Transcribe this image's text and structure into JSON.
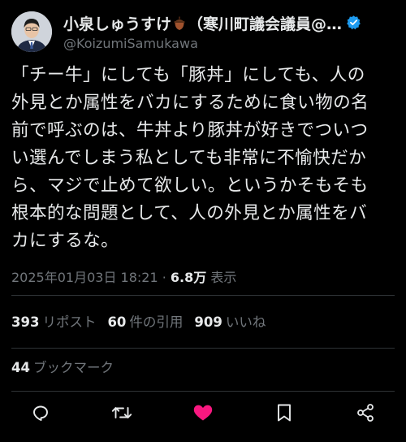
{
  "author": {
    "display_name_prefix": "小泉しゅうすけ",
    "display_name_suffix": "（寒川町議会議員@…",
    "handle": "@KoizumiSamukawa",
    "verified": true
  },
  "tweet": {
    "lines": [
      "「チー牛」にしても「豚丼」にしても、人の",
      "外見とか属性をバカにするために食い物の名",
      "前で呼ぶのは、牛丼より豚丼が好きでついつ",
      "い選んでしまう私としても非常に不愉快だか",
      "ら、マジで止めて欲しい。というかそもそも",
      "根本的な問題として、人の外見とか属性をバ",
      "カにするな。"
    ]
  },
  "meta": {
    "timestamp": "2025年01月03日 18:21",
    "separator": " · ",
    "views_count": "6.8万",
    "views_label": " 表示"
  },
  "stats": {
    "reposts_count": "393",
    "reposts_label": "リポスト",
    "quotes_count": "60",
    "quotes_label": "件の引用",
    "likes_count": "909",
    "likes_label": "いいね"
  },
  "bookmarks": {
    "count": "44",
    "label": "ブックマーク"
  },
  "colors": {
    "background": "#000000",
    "text": "#e7e9ea",
    "muted": "#71767b",
    "like_active": "#f91880",
    "verified": "#1d9bf0",
    "divider": "#2f3336"
  },
  "icons": [
    "acorn-icon",
    "verified-badge-icon",
    "reply-icon",
    "retweet-icon",
    "like-icon",
    "bookmark-icon",
    "share-icon"
  ]
}
